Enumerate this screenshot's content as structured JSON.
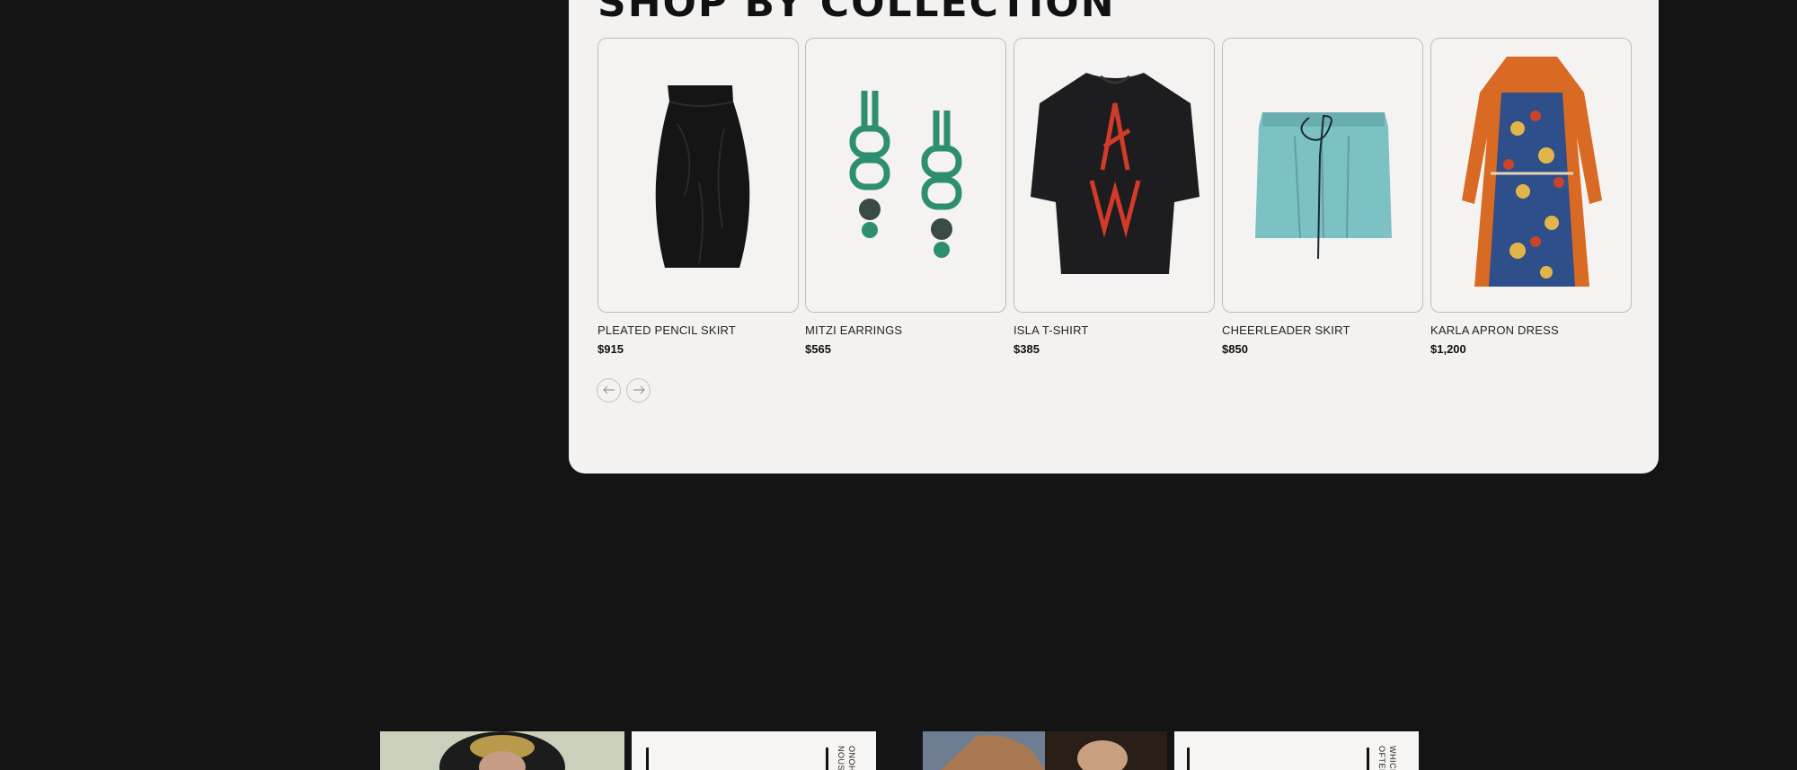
{
  "section": {
    "title": "SHOP BY COLLECTION"
  },
  "products": [
    {
      "name": "PLEATED PENCIL SKIRT",
      "price": "$915"
    },
    {
      "name": "MITZI EARRINGS",
      "price": "$565"
    },
    {
      "name": "ISLA T-SHIRT",
      "price": "$385"
    },
    {
      "name": "CHEERLEADER SKIRT",
      "price": "$850"
    },
    {
      "name": "KARLA APRON DRESS",
      "price": "$1,200"
    }
  ],
  "carousel": {
    "prev_icon": "arrow-left-icon",
    "next_icon": "arrow-right-icon"
  },
  "editorial": [
    {
      "side_text_1": "NOUS",
      "side_text_2": "ONOH"
    },
    {
      "side_text_1": "OFTEN",
      "side_text_2": "WHICH"
    }
  ],
  "colors": {
    "page_bg": "#141414",
    "panel_bg": "#f3f2f0",
    "text": "#111111",
    "border": "#bdbdbd"
  }
}
